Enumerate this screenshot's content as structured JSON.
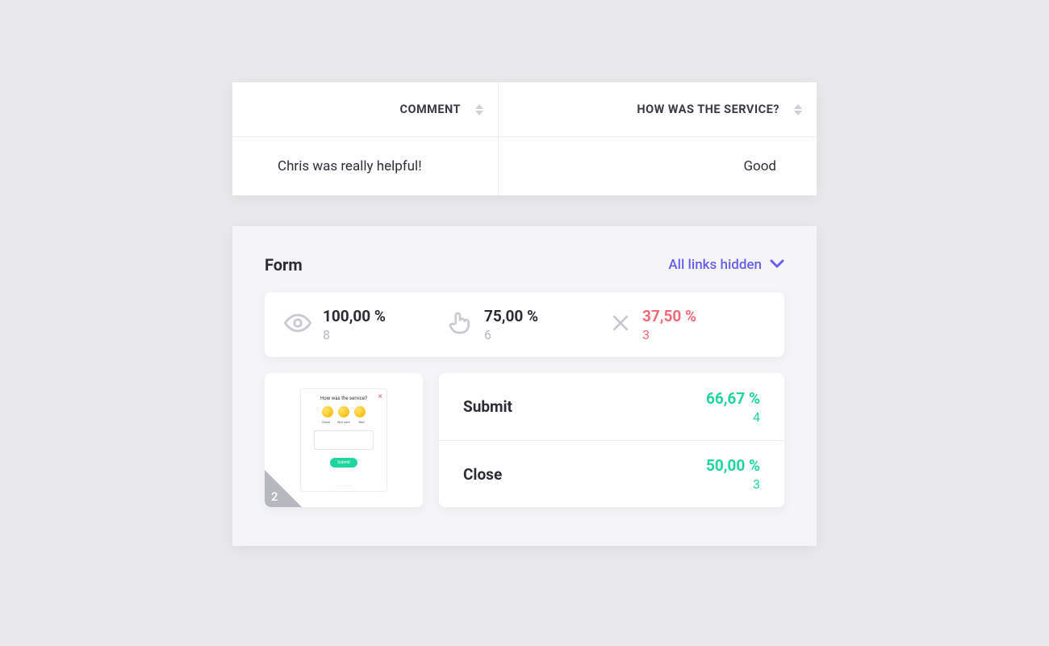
{
  "table": {
    "columns": {
      "comment": "COMMENT",
      "service": "HOW WAS THE SERVICE?"
    },
    "row": {
      "comment": "Chris was really helpful!",
      "service": "Good"
    }
  },
  "panel": {
    "title": "Form",
    "links_toggle": "All links hidden",
    "stats": {
      "views": {
        "pct": "100,00 %",
        "count": "8"
      },
      "clicks": {
        "pct": "75,00 %",
        "count": "6"
      },
      "closes": {
        "pct": "37,50 %",
        "count": "3"
      }
    },
    "preview": {
      "badge": "2",
      "title": "How was the service?",
      "options": [
        "Good",
        "Not sure",
        "Bad"
      ],
      "submit": "Submit"
    },
    "actions": [
      {
        "label": "Submit",
        "pct": "66,67 %",
        "count": "4"
      },
      {
        "label": "Close",
        "pct": "50,00 %",
        "count": "3"
      }
    ]
  }
}
